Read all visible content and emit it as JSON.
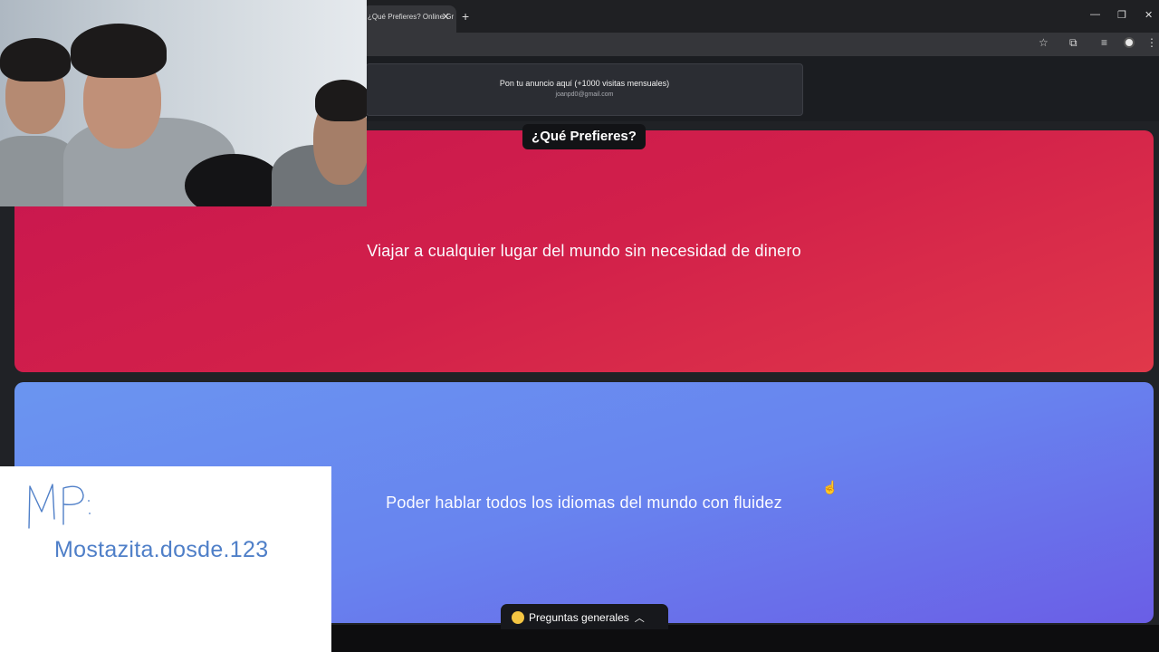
{
  "browser": {
    "tab_title": "¿Qué Prefieres? Online Gr",
    "tab_close_icon": "close-icon",
    "new_tab_icon": "plus-icon",
    "window_controls": [
      "minimize-icon",
      "restore-icon",
      "close-icon"
    ],
    "toolbar_icons": [
      "star-icon",
      "extensions-icon",
      "media-icon",
      "profile-icon",
      "menu-icon"
    ]
  },
  "ad": {
    "title": "Pon tu anuncio aquí (+1000 visitas mensuales)",
    "email": "joanpd0@gmail.com"
  },
  "game": {
    "title": "¿Qué Prefieres?",
    "option_a": "Viajar a cualquier lugar del mundo sin necesidad de dinero",
    "option_b": "Poder hablar todos los idiomas del mundo con fluidez",
    "category_label": "Preguntas generales",
    "category_icon": "tongue-face-emoji-icon"
  },
  "overlay": {
    "handwritten": "MP:",
    "alias": "Mostazita.dosde.123"
  },
  "colors": {
    "option_a": "#d2204a",
    "option_b": "#6884ef",
    "page_bg": "#202226",
    "alias_text": "#4f7fc8"
  }
}
